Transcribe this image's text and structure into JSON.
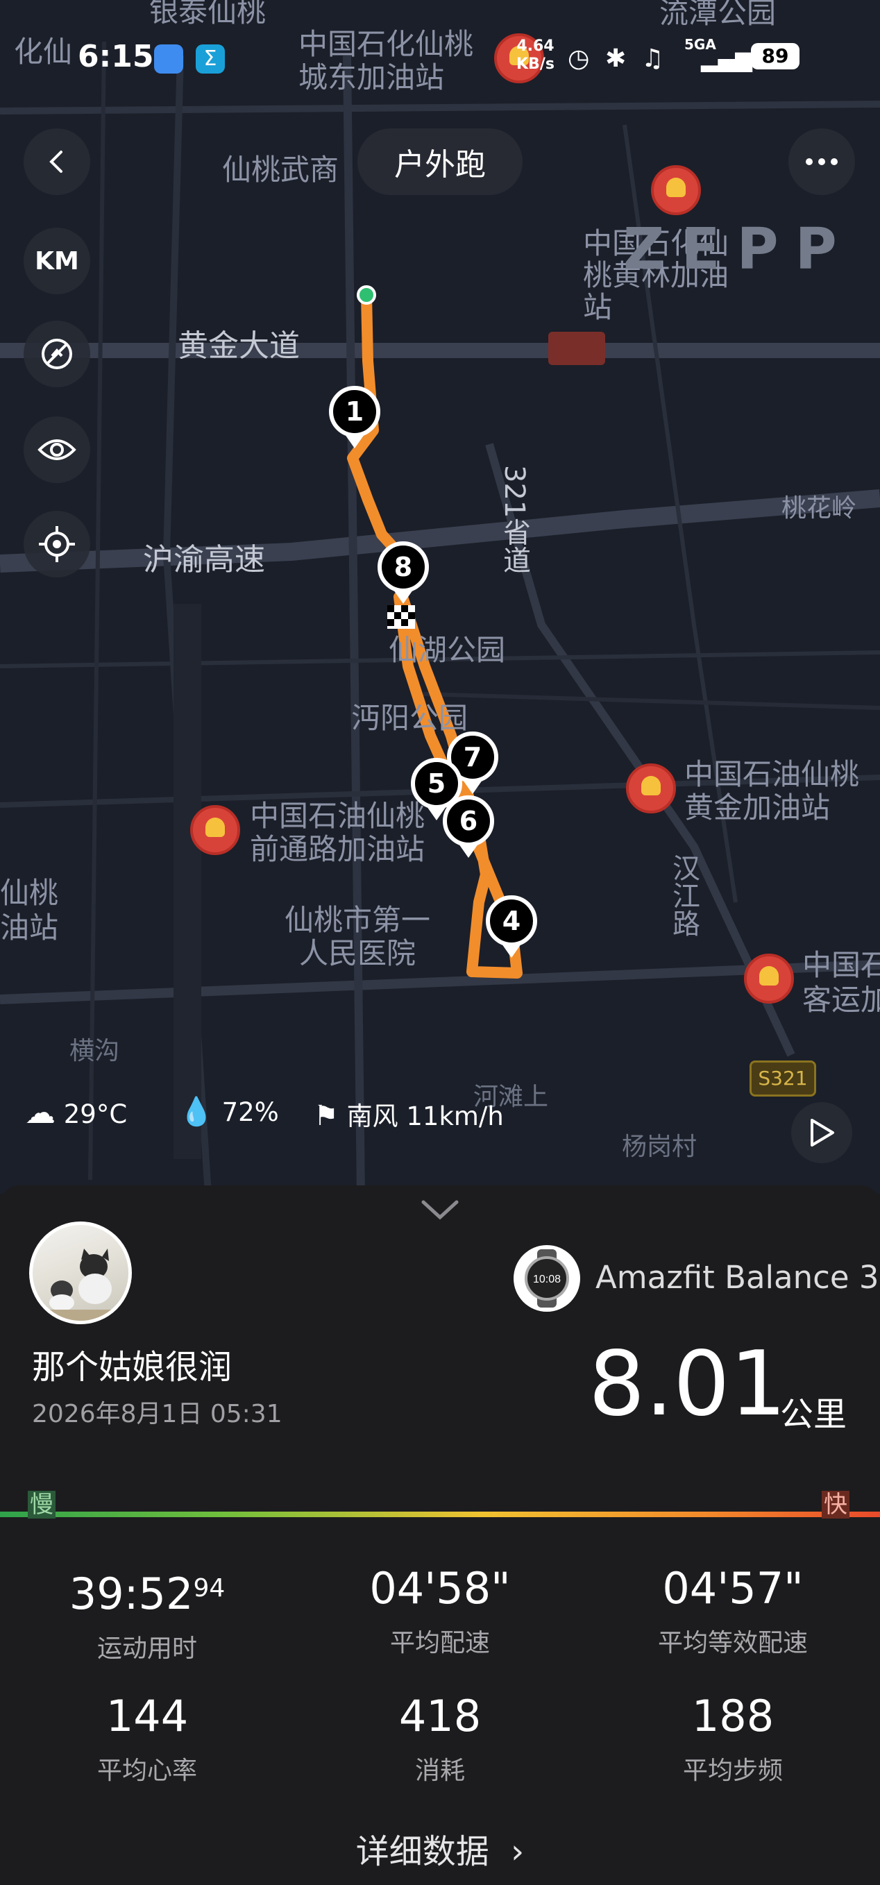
{
  "status_bar": {
    "time": "6:15",
    "net_speed_value": "4.64",
    "net_speed_unit": "KB/s",
    "network_type": "5GA",
    "battery": "89"
  },
  "header": {
    "title": "户外跑"
  },
  "watermark": "ZEPP",
  "map_controls": {
    "units_label": "KM"
  },
  "map_labels": {
    "huangjin_road": "黄金大道",
    "huyu_highway": "沪渝高速",
    "provincial_road": "321省道",
    "hanjiang_road": "汉江路",
    "sinopec_chengdong": "中国石化仙桃城东加油站",
    "sinopec_huanglin": "中国石化仙桃黄林加油站",
    "petrochina_huangjin": "中国石油仙桃黄金加油站",
    "petrochina_qiantong": "中国石油仙桃前通路加油站",
    "hospital": "仙桃市第一人民医院",
    "lake_park": "仙湖公园",
    "mianyang_park": "沔阳公园",
    "liutan_park": "流潭公园",
    "wushang": "仙桃武商",
    "taohualing": "桃花岭",
    "yinzuo": "银泰仙桃",
    "road_s321": "S321",
    "henggou": "横沟",
    "hetanshang": "河滩上",
    "yanggangcun": "杨岗村"
  },
  "route_markers": [
    "1",
    "4",
    "5",
    "6",
    "7",
    "8"
  ],
  "weather": {
    "temperature": "29°C",
    "humidity": "72%",
    "wind": "南风 11km/h"
  },
  "summary": {
    "username": "那个姑娘很润",
    "date": "2026年8月1日 05:31",
    "device": "Amazfit Balance 3",
    "distance": "8.01",
    "distance_unit": "公里",
    "slow_label": "慢",
    "fast_label": "快"
  },
  "stats": [
    {
      "value": "39:52",
      "value_sup": "94",
      "label": "运动用时"
    },
    {
      "value": "04'58\"",
      "value_sup": "",
      "label": "平均配速"
    },
    {
      "value": "04'57\"",
      "value_sup": "",
      "label": "平均等效配速"
    },
    {
      "value": "144",
      "value_sup": "",
      "label": "平均心率"
    },
    {
      "value": "418",
      "value_sup": "",
      "label": "消耗"
    },
    {
      "value": "188",
      "value_sup": "",
      "label": "平均步频"
    }
  ],
  "detail_link": "详细数据",
  "colors": {
    "route": "#f28d2b",
    "map_bg": "#1b1f29",
    "panel_bg": "#1c1c1e",
    "start_point": "#2fbf71"
  },
  "icons": [
    "back-arrow-icon",
    "more-dots-icon",
    "hide-icon",
    "eye-icon",
    "locate-icon",
    "cloud-icon",
    "drop-icon",
    "wind-flag-icon",
    "play-icon",
    "collapse-chevron-icon",
    "chevron-right-icon"
  ]
}
